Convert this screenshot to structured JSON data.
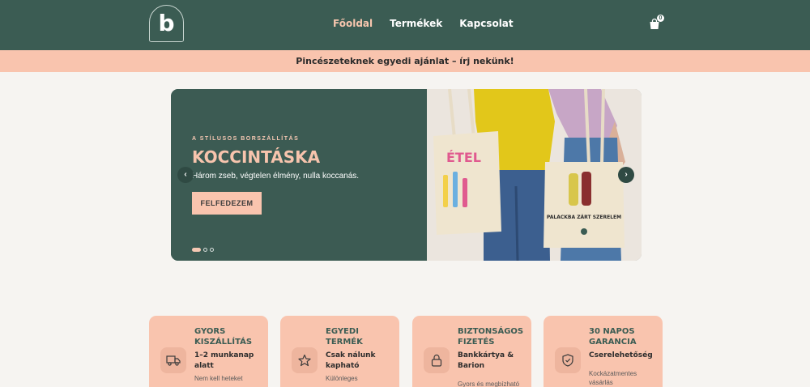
{
  "header": {
    "logo_letter": "b",
    "nav": [
      {
        "label": "Főoldal",
        "active": true
      },
      {
        "label": "Termékek",
        "active": false
      },
      {
        "label": "Kapcsolat",
        "active": false
      }
    ],
    "cart_count": "0",
    "icons": {
      "cart": "shopping-bag-icon"
    }
  },
  "promo": {
    "text": "Pincészeteknek egyedi ajánlat – írj nekünk!"
  },
  "hero": {
    "eyebrow": "A STÍLUSOS BORSZÁLLÍTÁS",
    "title": "KOCCINTÁSKA",
    "subtitle": "Három zseb, végtelen élmény, nulla koccanás.",
    "cta": "FELFEDEZEM",
    "slides_total": 3,
    "active_slide": 1,
    "bag_left_text": "ÉTEL",
    "bag_right_text": "PALACKBA ZÁRT SZERELEM",
    "prev_icon": "chevron-left-icon",
    "next_icon": "chevron-right-icon"
  },
  "features": [
    {
      "title": "GYORS KISZÁLLÍTÁS",
      "main": "1–2 munkanap alatt",
      "sub": "Nem kell heteket",
      "icon": "truck-icon"
    },
    {
      "title": "EGYEDI TERMÉK",
      "main": "Csak nálunk kapható",
      "sub": "Különleges",
      "icon": "star-icon"
    },
    {
      "title": "BIZTONSÁGOS FIZETÉS",
      "main": "Bankkártya & Barion",
      "sub": "Gyors és megbízható",
      "icon": "lock-icon"
    },
    {
      "title": "30 NAPOS GARANCIA",
      "main": "Cserelehetőség",
      "sub": "Kockázatmentes vásárlás",
      "icon": "shield-check-icon"
    }
  ],
  "colors": {
    "header_bg": "#3b5c53",
    "accent_peach": "#f9c4ae",
    "page_bg": "#f6f4f1"
  }
}
